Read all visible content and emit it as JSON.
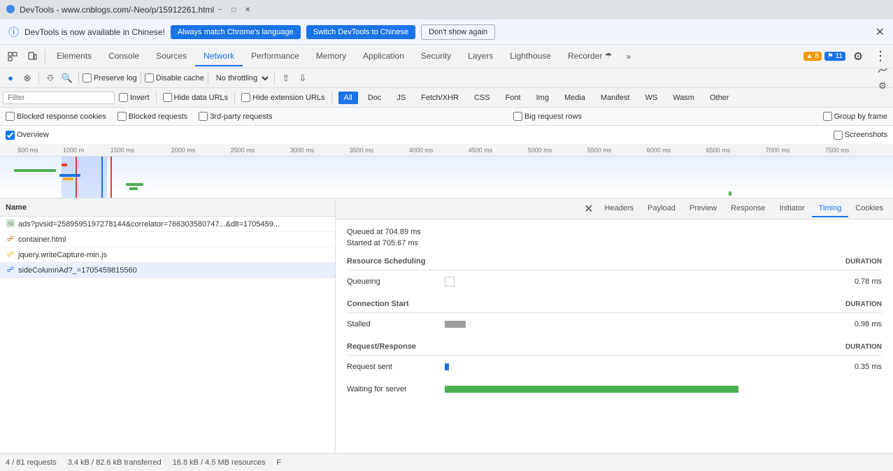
{
  "titlebar": {
    "title": "DevTools - www.cnblogs.com/-Neo/p/15912261.html"
  },
  "notification": {
    "message": "DevTools is now available in Chinese!",
    "btn1": "Always match Chrome's language",
    "btn2": "Switch DevTools to Chinese",
    "btn3": "Don't show again"
  },
  "tabs": {
    "items": [
      {
        "label": "Elements"
      },
      {
        "label": "Console"
      },
      {
        "label": "Sources"
      },
      {
        "label": "Network"
      },
      {
        "label": "Performance"
      },
      {
        "label": "Memory"
      },
      {
        "label": "Application"
      },
      {
        "label": "Security"
      },
      {
        "label": "Layers"
      },
      {
        "label": "Lighthouse"
      },
      {
        "label": "Recorder"
      }
    ],
    "overflow_label": "»",
    "active": "Network",
    "warning_badge": "8",
    "info_badge": "11"
  },
  "toolbar": {
    "preserve_log": "Preserve log",
    "disable_cache": "Disable cache",
    "throttle": "No throttling"
  },
  "filter": {
    "placeholder": "Filter",
    "invert": "Invert",
    "hide_data_urls": "Hide data URLs",
    "hide_extension_urls": "Hide extension URLs",
    "types": [
      "All",
      "Doc",
      "JS",
      "Fetch/XHR",
      "CSS",
      "Font",
      "Img",
      "Media",
      "Manifest",
      "WS",
      "Wasm",
      "Other"
    ]
  },
  "options": {
    "blocked_response_cookies": "Blocked response cookies",
    "blocked_requests": "Blocked requests",
    "third_party_requests": "3rd-party requests",
    "big_request_rows": "Big request rows",
    "group_by_frame": "Group by frame",
    "overview": "Overview",
    "screenshots": "Screenshots"
  },
  "ruler": {
    "ticks": [
      "500 ms",
      "1000 m",
      "1500 ms",
      "2000 ms",
      "2500 ms",
      "3000 ms",
      "3500 ms",
      "4000 ms",
      "4500 ms",
      "5000 ms",
      "5500 ms",
      "6000 ms",
      "6500 ms",
      "7000 ms",
      "7500 ms"
    ]
  },
  "file_list": {
    "header": "Name",
    "files": [
      {
        "name": "ads?pvsid=2589595197278144&correlator=766303580747...&dlt=1705459...",
        "type": "img"
      },
      {
        "name": "container.html",
        "type": "html"
      },
      {
        "name": "jquery.writeCapture-min.js",
        "type": "js"
      },
      {
        "name": "sideColumnAd?_=1705459815560",
        "type": "doc"
      }
    ]
  },
  "detail_tabs": {
    "items": [
      "Headers",
      "Payload",
      "Preview",
      "Response",
      "Initiator",
      "Timing",
      "Cookies"
    ],
    "active": "Timing"
  },
  "timing": {
    "queued_at": "Queued at 704.89 ms",
    "started_at": "Started at 705.67 ms",
    "sections": [
      {
        "title": "Resource Scheduling",
        "duration_label": "DURATION",
        "rows": [
          {
            "label": "Queueing",
            "bar_type": "empty",
            "duration": "0.78 ms"
          }
        ]
      },
      {
        "title": "Connection Start",
        "duration_label": "DURATION",
        "rows": [
          {
            "label": "Stalled",
            "bar_type": "gray",
            "duration": "0.98 ms"
          }
        ]
      },
      {
        "title": "Request/Response",
        "duration_label": "DURATION",
        "rows": [
          {
            "label": "Request sent",
            "bar_type": "blue",
            "duration": "0.35 ms"
          },
          {
            "label": "Waiting for server",
            "bar_type": "green",
            "duration": ""
          }
        ]
      }
    ]
  },
  "status_bar": {
    "requests": "4 / 81 requests",
    "transferred": "3.4 kB / 82.6 kB transferred",
    "resources": "16.8 kB / 4.5 MB resources",
    "finish": "F"
  }
}
